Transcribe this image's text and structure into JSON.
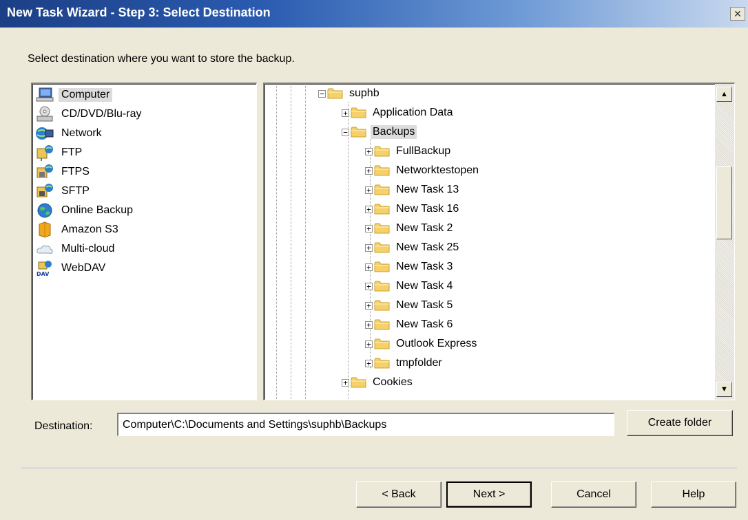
{
  "window": {
    "title": "New Task Wizard - Step 3: Select Destination",
    "close_glyph": "✕"
  },
  "instruction": "Select destination where you want to store the backup.",
  "sources": [
    {
      "label": "Computer",
      "icon": "computer-icon",
      "selected": true
    },
    {
      "label": "CD/DVD/Blu-ray",
      "icon": "disc-drive-icon"
    },
    {
      "label": "Network",
      "icon": "network-icon"
    },
    {
      "label": "FTP",
      "icon": "ftp-icon"
    },
    {
      "label": "FTPS",
      "icon": "ftps-icon"
    },
    {
      "label": "SFTP",
      "icon": "sftp-icon"
    },
    {
      "label": "Online Backup",
      "icon": "globe-icon"
    },
    {
      "label": "Amazon S3",
      "icon": "amazon-s3-icon"
    },
    {
      "label": "Multi-cloud",
      "icon": "cloud-icon"
    },
    {
      "label": "WebDAV",
      "icon": "webdav-icon",
      "badge": "DAV"
    }
  ],
  "tree": {
    "items": [
      {
        "label": "suphb",
        "level": 0,
        "expander": "−"
      },
      {
        "label": "Application Data",
        "level": 1,
        "expander": "+"
      },
      {
        "label": "Backups",
        "level": 1,
        "expander": "−",
        "selected": true
      },
      {
        "label": "FullBackup",
        "level": 2,
        "expander": "+"
      },
      {
        "label": "Networktestopen",
        "level": 2,
        "expander": "+"
      },
      {
        "label": "New Task 13",
        "level": 2,
        "expander": "+"
      },
      {
        "label": "New Task 16",
        "level": 2,
        "expander": "+"
      },
      {
        "label": "New Task 2",
        "level": 2,
        "expander": "+"
      },
      {
        "label": "New Task 25",
        "level": 2,
        "expander": "+"
      },
      {
        "label": "New Task 3",
        "level": 2,
        "expander": "+"
      },
      {
        "label": "New Task 4",
        "level": 2,
        "expander": "+"
      },
      {
        "label": "New Task 5",
        "level": 2,
        "expander": "+"
      },
      {
        "label": "New Task 6",
        "level": 2,
        "expander": "+"
      },
      {
        "label": "Outlook Express",
        "level": 2,
        "expander": "+"
      },
      {
        "label": "tmpfolder",
        "level": 2,
        "expander": "+"
      },
      {
        "label": "Cookies",
        "level": 1,
        "expander": "+"
      }
    ],
    "scroll_up_glyph": "▲",
    "scroll_down_glyph": "▼"
  },
  "destination": {
    "label": "Destination:",
    "value": "Computer\\C:\\Documents and Settings\\suphb\\Backups"
  },
  "buttons": {
    "create_folder": "Create folder",
    "back": "< Back",
    "next": "Next >",
    "cancel": "Cancel",
    "help": "Help"
  },
  "colors": {
    "folder": "#f5d06b",
    "folder_edge": "#c9a227",
    "selection": "#dcdcdc"
  }
}
